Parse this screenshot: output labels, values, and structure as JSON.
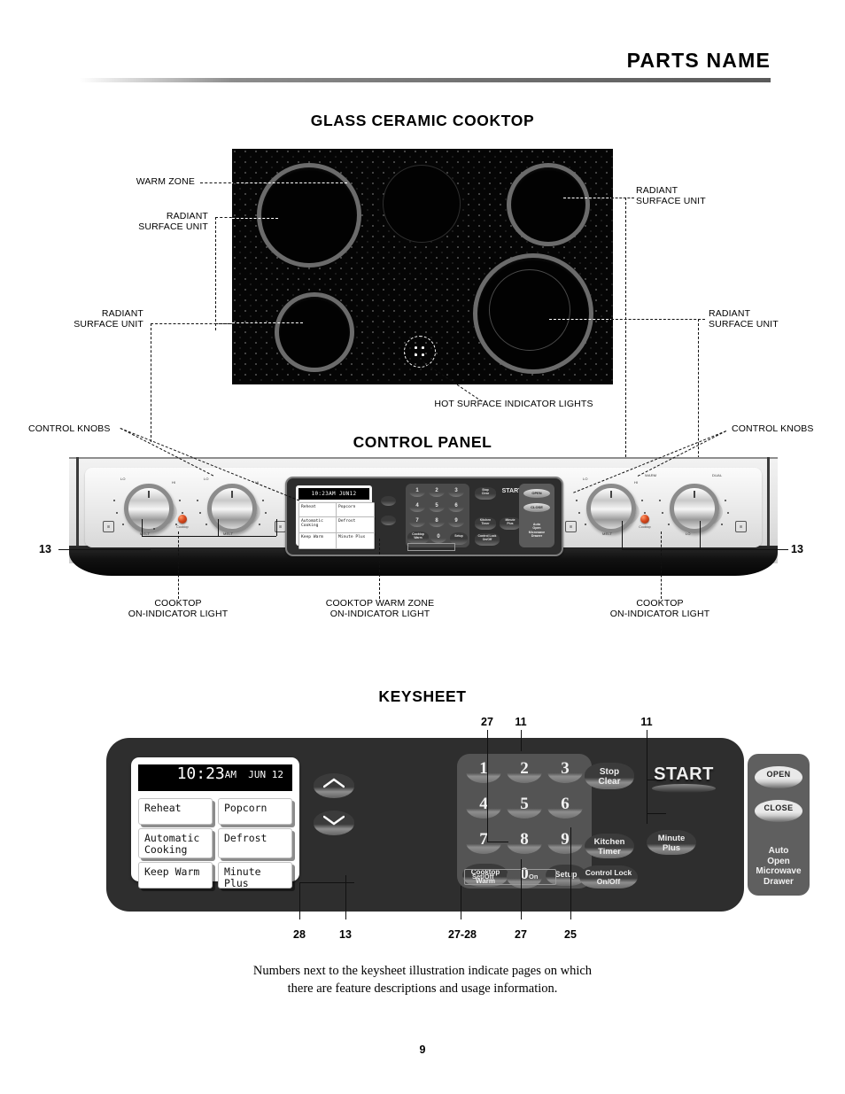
{
  "header": {
    "title": "PARTS NAME"
  },
  "sections": {
    "cooktop_title": "GLASS CERAMIC COOKTOP",
    "panel_title": "CONTROL PANEL",
    "keysheet_title": "KEYSHEET"
  },
  "cooktop_labels": {
    "warm_zone": "WARM ZONE",
    "radiant_left_top": "RADIANT\nSURFACE UNIT",
    "radiant_left_bottom": "RADIANT\nSURFACE UNIT",
    "radiant_right_top": "RADIANT\nSURFACE UNIT",
    "radiant_right_bottom": "RADIANT\nSURFACE UNIT",
    "hot_surface": "HOT SURFACE INDICATOR LIGHTS"
  },
  "panel_labels": {
    "control_knobs_left": "CONTROL KNOBS",
    "control_knobs_right": "CONTROL KNOBS",
    "cooktop_on_left": "COOKTOP\nON-INDICATOR LIGHT",
    "cooktop_warm_zone_on": "COOKTOP WARM ZONE\nON-INDICATOR LIGHT",
    "cooktop_on_right": "COOKTOP\nON-INDICATOR LIGHT",
    "page_ref_left": "13",
    "page_ref_right": "13",
    "knob_marks": {
      "lo": "LO",
      "hi": "HI",
      "melt": "MELT",
      "warm": "WARM",
      "dual": "DUAL"
    },
    "indicator_caption_left": "Cooktop",
    "indicator_caption_right": "Cooktop"
  },
  "keysheet": {
    "display": {
      "time": "10:23",
      "meridiem": "AM",
      "date": "JUN 12",
      "menu_buttons": [
        "Reheat",
        "Popcorn",
        "Automatic\nCooking",
        "Defrost",
        "Keep Warm",
        "Minute Plus"
      ]
    },
    "keypad": {
      "digits": [
        "1",
        "2",
        "3",
        "4",
        "5",
        "6",
        "7",
        "8",
        "9"
      ],
      "zero": "0",
      "cooktop_warm": "Cooktop\nWarm",
      "setup": "Setup",
      "sub_set_off": "Set/Off",
      "sub_on": "On"
    },
    "function_keys": {
      "stop_clear": "Stop\nClear",
      "start": "START",
      "kitchen_timer": "Kitchen\nTimer",
      "minute_plus": "Minute\nPlus",
      "control_lock": "Control Lock\nOn/Off"
    },
    "drawer": {
      "open": "OPEN",
      "close": "CLOSE",
      "label": "Auto\nOpen\nMicrowave\nDrawer"
    },
    "page_refs_top": [
      "27",
      "11",
      "11"
    ],
    "page_refs_bottom": [
      "28",
      "13",
      "27-28",
      "27",
      "25"
    ]
  },
  "caption": "Numbers next to the keysheet illustration indicate pages on which\nthere are feature descriptions and usage information.",
  "folio": "9",
  "colors": {
    "accent_indicator": "#d8491e",
    "panel_dark": "#2e2e2e",
    "cooktop_black": "#050505"
  }
}
